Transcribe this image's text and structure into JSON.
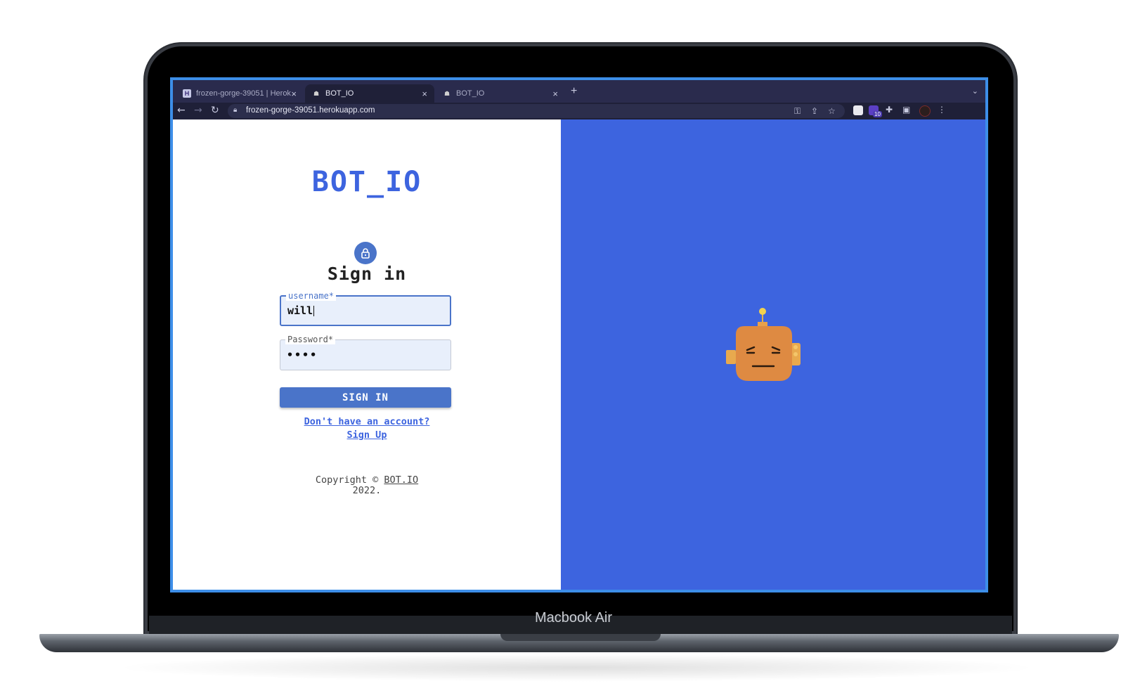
{
  "device": {
    "label": "Macbook Air"
  },
  "browser": {
    "tabs": [
      {
        "title": "frozen-gorge-39051 | Heroku",
        "active": false
      },
      {
        "title": "BOT_IO",
        "active": true
      },
      {
        "title": "BOT_IO",
        "active": false
      }
    ],
    "tab_close": "×",
    "new_tab": "+",
    "url": "frozen-gorge-39051.herokuapp.com",
    "extension_badge": "10"
  },
  "login": {
    "logo": "BOT_IO",
    "title": "Sign in",
    "username_label": "username*",
    "username_value": "will",
    "password_label": "Password*",
    "password_value": "••••",
    "submit_label": "SIGN IN",
    "signup_prompt": "Don't have an account?",
    "signup_link": "Sign Up",
    "copyright_prefix": "Copyright ©",
    "copyright_brand": "BOT.IO",
    "copyright_year": "2022."
  },
  "colors": {
    "accent": "#3d64df",
    "button": "#4a74c9",
    "robot": "#de8a42"
  }
}
